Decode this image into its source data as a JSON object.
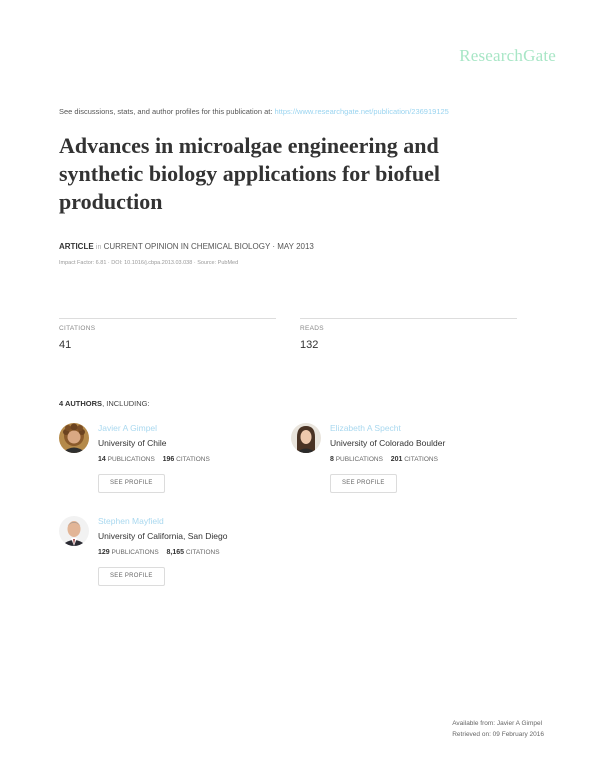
{
  "brand": "ResearchGate",
  "see_line": {
    "text": "See discussions, stats, and author profiles for this publication at:",
    "url": "https://www.researchgate.net/publication/236919125"
  },
  "title_lines": [
    "Advances in microalgae engineering and",
    "synthetic biology applications for biofuel",
    "production"
  ],
  "meta": {
    "type": "ARTICLE",
    "in": "in",
    "journal": "CURRENT OPINION IN CHEMICAL BIOLOGY · MAY 2013",
    "sub": "Impact Factor: 6.81 · DOI: 10.1016/j.cbpa.2013.03.038 · Source: PubMed"
  },
  "stats": {
    "citations_label": "CITATIONS",
    "citations_value": "41",
    "reads_label": "READS",
    "reads_value": "132"
  },
  "authors_heading": {
    "count": "4 AUTHORS",
    "suffix": ", INCLUDING:"
  },
  "authors": [
    {
      "name": "Javier A Gimpel",
      "institution": "University of Chile",
      "publications": "14",
      "publications_label": "PUBLICATIONS",
      "citations": "196",
      "citations_label": "CITATIONS",
      "button": "SEE PROFILE"
    },
    {
      "name": "Elizabeth A Specht",
      "institution": "University of Colorado Boulder",
      "publications": "8",
      "publications_label": "PUBLICATIONS",
      "citations": "201",
      "citations_label": "CITATIONS",
      "button": "SEE PROFILE"
    },
    {
      "name": "Stephen Mayfield",
      "institution": "University of California, San Diego",
      "publications": "129",
      "publications_label": "PUBLICATIONS",
      "citations": "8,165",
      "citations_label": "CITATIONS",
      "button": "SEE PROFILE"
    }
  ],
  "footer": {
    "available": "Available from: Javier A Gimpel",
    "retrieved": "Retrieved on: 09 February 2016"
  }
}
